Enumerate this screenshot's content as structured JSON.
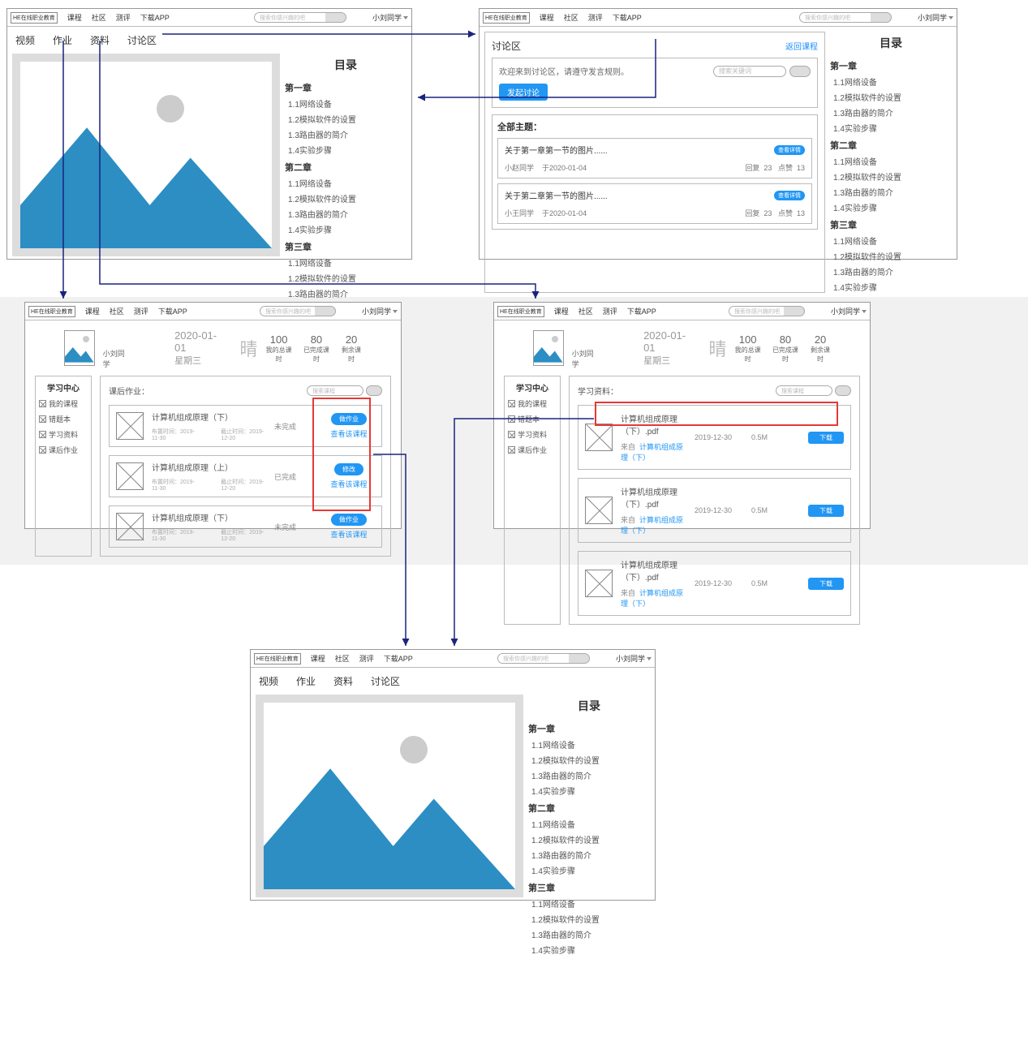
{
  "global": {
    "logo": "HE在线职业教育",
    "nav": [
      "课程",
      "社区",
      "测评",
      "下载APP"
    ],
    "searchPlaceholder": "搜索你感兴趣的吧",
    "user": "小刘同学"
  },
  "courseTabs": [
    "视频",
    "作业",
    "资料",
    "讨论区"
  ],
  "toc": {
    "title": "目录",
    "chapters": [
      {
        "head": "第一章",
        "items": [
          "1.1网络设备",
          "1.2模拟软件的设置",
          "1.3路由器的简介",
          "1.4实验步骤"
        ]
      },
      {
        "head": "第二章",
        "items": [
          "1.1网络设备",
          "1.2模拟软件的设置",
          "1.3路由器的简介",
          "1.4实验步骤"
        ]
      },
      {
        "head": "第三章",
        "items": [
          "1.1网络设备",
          "1.2模拟软件的设置",
          "1.3路由器的简介",
          "1.4实验步骤"
        ]
      }
    ]
  },
  "discuss": {
    "title": "讨论区",
    "back": "返回课程",
    "welcome": "欢迎来到讨论区，请遵守发言规则。",
    "searchPH": "搜索关键词",
    "postBtn": "发起讨论",
    "allHead": "全部主题：",
    "detailTag": "查看详情",
    "threads": [
      {
        "title": "关于第一章第一节的图片......",
        "author": "小赵同学",
        "date": "于2020-01-04",
        "reply": "回复",
        "replyN": "23",
        "like": "点赞",
        "likeN": "13"
      },
      {
        "title": "关于第二章第一节的图片......",
        "author": "小王同学",
        "date": "于2020-01-04",
        "reply": "回复",
        "replyN": "23",
        "like": "点赞",
        "likeN": "13"
      }
    ]
  },
  "study": {
    "name": "小刘同学",
    "date": "2020-01-01",
    "dow": "星期三",
    "weather": "晴",
    "stats": [
      {
        "n": "100",
        "l": "我的总课时"
      },
      {
        "n": "80",
        "l": "已完成课时"
      },
      {
        "n": "20",
        "l": "剩余课时"
      }
    ],
    "navTitle": "学习中心",
    "navItems": [
      "我的课程",
      "错题本",
      "学习资料",
      "课后作业"
    ]
  },
  "homework": {
    "head": "课后作业：",
    "searchPH": "搜索课程",
    "rows": [
      {
        "title": "计算机组成原理（下）",
        "pub": "布置时间：2019-11-30",
        "due": "截止时间：2019-12-20",
        "status": "未完成",
        "btn": "做作业",
        "link": "查看该课程"
      },
      {
        "title": "计算机组成原理（上）",
        "pub": "布置时间：2019-11-30",
        "due": "截止时间：2019-12-20",
        "status": "已完成",
        "btn": "修改",
        "link": "查看该课程"
      },
      {
        "title": "计算机组成原理（下）",
        "pub": "布置时间：2019-11-30",
        "due": "截止时间：2019-12-20",
        "status": "未完成",
        "btn": "做作业",
        "link": "查看该课程"
      }
    ]
  },
  "materials": {
    "head": "学习资料：",
    "searchPH": "搜索课程",
    "fromLabel": "来自",
    "dl": "下载",
    "rows": [
      {
        "title": "计算机组成原理（下）.pdf",
        "course": "计算机组成原理（下）",
        "date": "2019-12-30",
        "size": "0.5M"
      },
      {
        "title": "计算机组成原理（下）.pdf",
        "course": "计算机组成原理（下）",
        "date": "2019-12-30",
        "size": "0.5M"
      },
      {
        "title": "计算机组成原理（下）.pdf",
        "course": "计算机组成原理（下）",
        "date": "2019-12-30",
        "size": "0.5M"
      }
    ]
  }
}
